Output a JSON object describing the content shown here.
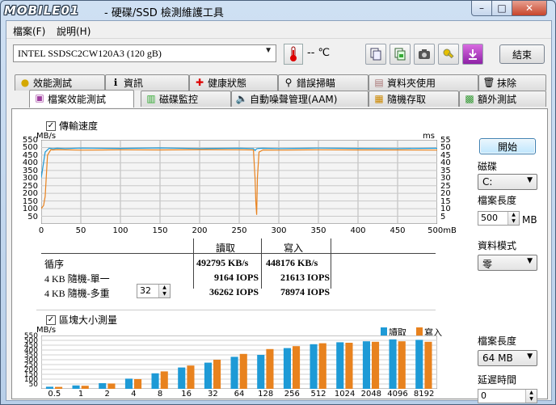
{
  "window": {
    "logo_text": "MOBILE01",
    "title": "- 硬碟/SSD 檢測維護工具",
    "min_label": "–",
    "max_label": "□",
    "close_label": "✕"
  },
  "menu": {
    "file": "檔案(F)",
    "help": "說明(H)"
  },
  "toolbar": {
    "device": "INTEL   SSDSC2CW120A3 (120 gB)",
    "temperature": "-- ℃",
    "exit_label": "結束",
    "icons": [
      "thermometer-icon",
      "copy-icon",
      "save-icon",
      "camera-icon",
      "tools-icon",
      "download-icon"
    ]
  },
  "tabs_row1": [
    "效能測試",
    "資訊",
    "健康狀態",
    "錯誤掃瞄",
    "資料夾使用",
    "抹除"
  ],
  "tabs_row2": [
    "檔案效能測試",
    "磁碟監控",
    "自動噪聲管理(AAM)",
    "隨機存取",
    "額外測試"
  ],
  "transfer": {
    "checkbox_label": "傳輸速度",
    "left_unit": "MB/s",
    "right_unit": "ms",
    "y_ticks": [
      "550",
      "500",
      "450",
      "400",
      "350",
      "300",
      "250",
      "200",
      "150",
      "100",
      "50"
    ],
    "y2_ticks": [
      "55",
      "50",
      "45",
      "40",
      "35",
      "30",
      "25",
      "20",
      "15",
      "10",
      "5"
    ],
    "x_ticks": [
      "0",
      "50",
      "100",
      "150",
      "200",
      "250",
      "300",
      "350",
      "400",
      "450",
      "500mB"
    ]
  },
  "results": {
    "read_header": "讀取",
    "write_header": "寫入",
    "rows": [
      {
        "label": "循序",
        "read": "492795 KB/s",
        "write": "448176 KB/s"
      },
      {
        "label": "4 KB 隨機-單一",
        "read": "9164 IOPS",
        "write": "21613 IOPS"
      },
      {
        "label": "4 KB 隨機-多重",
        "read": "36262 IOPS",
        "write": "78974 IOPS"
      }
    ],
    "queue_depth": "32"
  },
  "block": {
    "checkbox_label": "區塊大小測量",
    "unit": "MB/s",
    "legend_read": "讀取",
    "legend_write": "寫入",
    "read_color": "#1e9ad6",
    "write_color": "#e8821e",
    "y_ticks": [
      "550",
      "500",
      "450",
      "400",
      "350",
      "300",
      "250",
      "200",
      "150",
      "100",
      "50"
    ]
  },
  "right": {
    "start_label": "開始",
    "disk_label": "磁碟",
    "disk_value": "C:",
    "file_length_label": "檔案長度",
    "file_length_value": "500",
    "file_length_unit": "MB",
    "data_mode_label": "資料模式",
    "data_mode_value": "零",
    "block_file_length_label": "檔案長度",
    "block_file_length_value": "64 MB",
    "delay_label": "延遲時間",
    "delay_value": "0"
  },
  "chart_data": [
    {
      "type": "line",
      "title": "傳輸速度",
      "ylabel": "MB/s",
      "y2label": "ms",
      "xlabel": "mB",
      "xlim": [
        0,
        500
      ],
      "ylim": [
        0,
        550
      ],
      "series": [
        {
          "name": "讀取",
          "x": [
            0,
            5,
            10,
            15,
            20,
            30,
            50,
            100,
            150,
            200,
            250,
            268,
            270,
            272,
            274,
            280,
            300,
            350,
            400,
            450,
            500
          ],
          "values": [
            300,
            470,
            495,
            492,
            495,
            493,
            496,
            494,
            497,
            493,
            495,
            493,
            480,
            492,
            494,
            495,
            493,
            496,
            494,
            493,
            495
          ]
        },
        {
          "name": "寫入",
          "x": [
            0,
            3,
            5,
            8,
            12,
            15,
            20,
            50,
            100,
            150,
            200,
            250,
            268,
            270,
            271,
            272,
            273,
            275,
            280,
            300,
            350,
            400,
            450,
            500
          ],
          "values": [
            100,
            120,
            180,
            450,
            485,
            484,
            486,
            483,
            485,
            484,
            486,
            485,
            484,
            300,
            140,
            60,
            300,
            470,
            484,
            483,
            485,
            484,
            484,
            483
          ]
        }
      ]
    },
    {
      "type": "bar",
      "title": "區塊大小測量",
      "ylabel": "MB/s",
      "categories": [
        "0.5",
        "1",
        "2",
        "4",
        "8",
        "16",
        "32",
        "64",
        "128",
        "256",
        "512",
        "1024",
        "2048",
        "4096",
        "8192"
      ],
      "ylim": [
        0,
        550
      ],
      "series": [
        {
          "name": "讀取",
          "values": [
            22,
            35,
            58,
            105,
            160,
            220,
            270,
            330,
            350,
            420,
            460,
            480,
            490,
            510,
            505
          ]
        },
        {
          "name": "寫入",
          "values": [
            20,
            32,
            55,
            100,
            180,
            240,
            300,
            360,
            410,
            440,
            470,
            475,
            485,
            490,
            485
          ]
        }
      ]
    }
  ]
}
